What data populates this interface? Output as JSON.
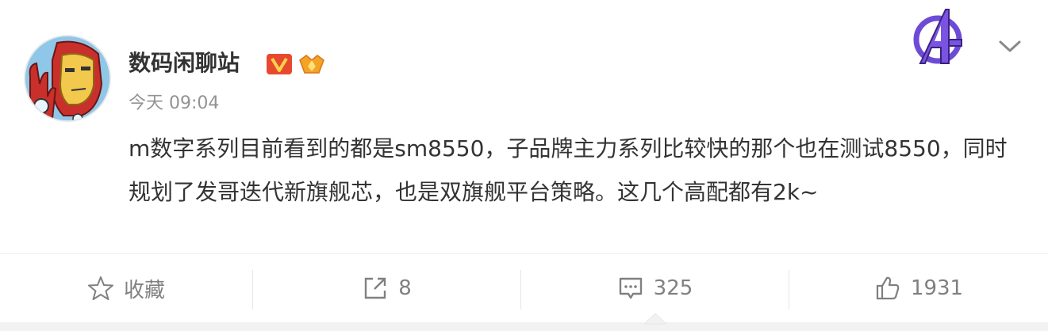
{
  "post": {
    "author": "数码闲聊站",
    "time": "今天 09:04",
    "text": "m数字系列目前看到的都是sm8550，子品牌主力系列比较快的那个也在测试8550，同时规划了发哥迭代新旗舰芯，也是双旗舰平台策略。这几个高配都有2k~",
    "badges": [
      "verified-v-badge",
      "fan-level-badge"
    ]
  },
  "actions": {
    "favorite_label": "收藏",
    "repost_count": "8",
    "comment_count": "325",
    "like_count": "1931"
  },
  "colors": {
    "text": "#333333",
    "muted": "#939393",
    "action": "#808080",
    "verified_badge": "#e8492e",
    "level_badge": "#f4a326"
  },
  "icons": {
    "header_right": [
      "avengers-logo",
      "chevron-down-icon"
    ],
    "action_bar": [
      "star-icon",
      "share-icon",
      "comment-icon",
      "thumbs-up-icon"
    ]
  }
}
